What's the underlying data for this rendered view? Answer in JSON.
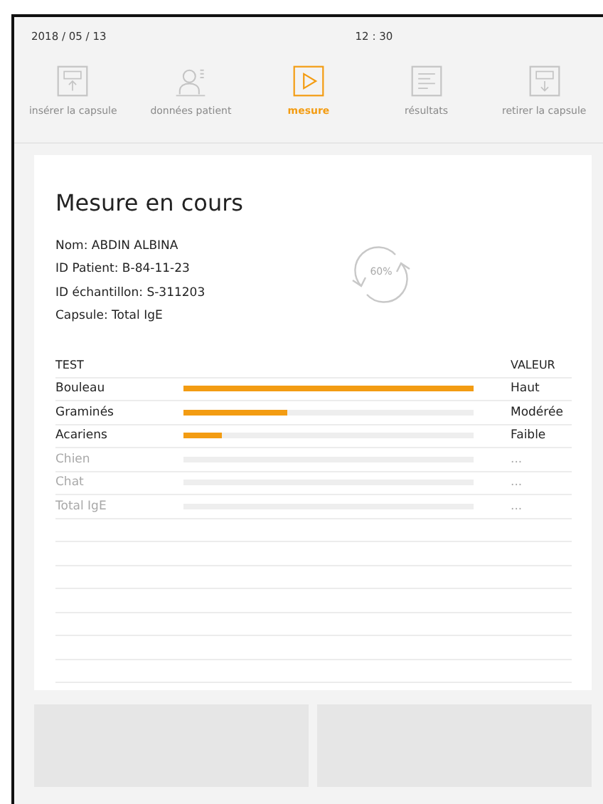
{
  "status_bar": {
    "date": "2018 / 05 / 13",
    "time": "12 : 30"
  },
  "nav": [
    {
      "label": "insérer la capsule",
      "selected": false
    },
    {
      "label": "données patient",
      "selected": false
    },
    {
      "label": "mesure",
      "selected": true
    },
    {
      "label": "résultats",
      "selected": false
    },
    {
      "label": "retirer la capsule",
      "selected": false
    }
  ],
  "title": "Mesure en cours",
  "info": [
    "Nom: ABDIN ALBINA",
    "ID Patient: B-84-11-23",
    "ID échantillon: S-311203",
    "Capsule: Total IgE"
  ],
  "progress": {
    "reading": "60%"
  },
  "table": {
    "columns": [
      "TEST",
      "VALEUR"
    ],
    "rows": [
      {
        "test": "Bouleau",
        "level": 1.0,
        "value": "Haut",
        "disabled": false
      },
      {
        "test": "Graminés",
        "level": 0.36,
        "value": "Modérée",
        "disabled": false
      },
      {
        "test": "Acariens",
        "level": 0.13,
        "value": "Faible",
        "disabled": false
      },
      {
        "test": "Chien",
        "level": 0,
        "value": "...",
        "disabled": true
      },
      {
        "test": "Chat",
        "level": 0,
        "value": "...",
        "disabled": true
      },
      {
        "test": "Total IgE",
        "level": 0,
        "value": "...",
        "disabled": true
      }
    ]
  }
}
